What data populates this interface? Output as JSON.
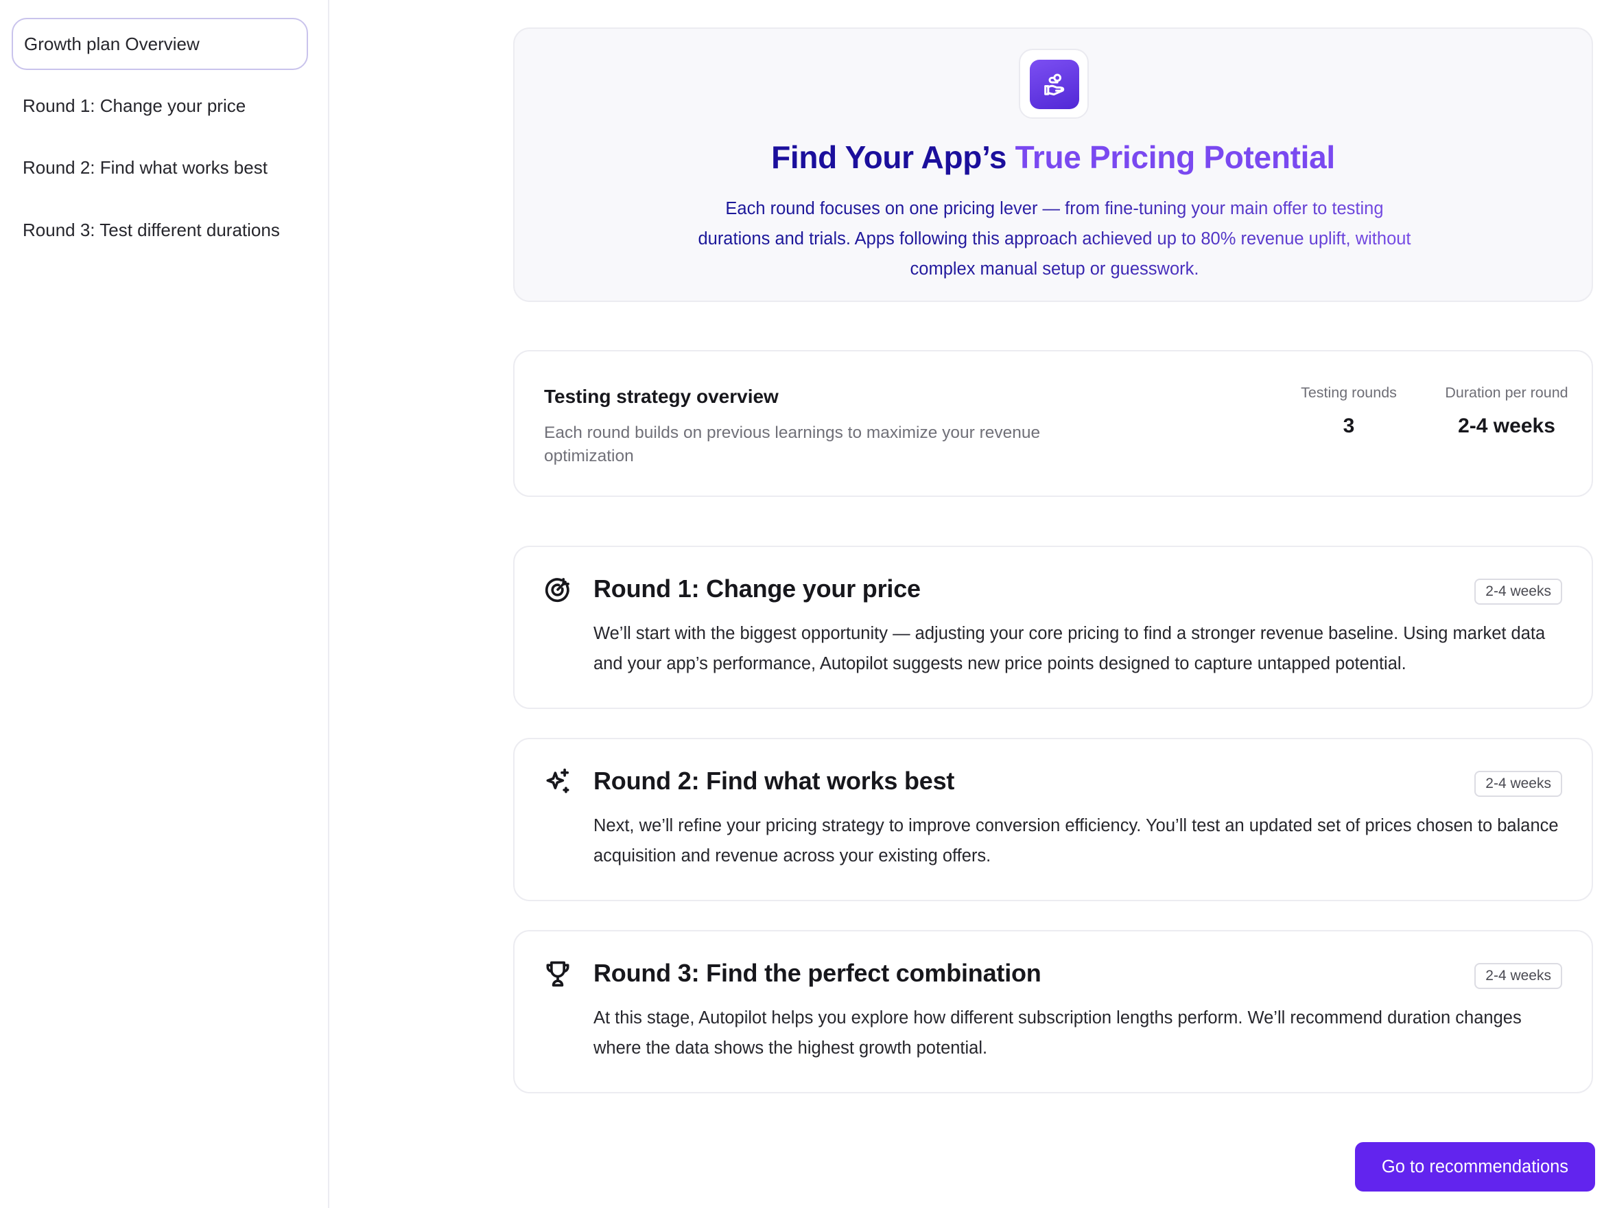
{
  "sidebar": {
    "items": [
      {
        "label": "Growth plan Overview",
        "active": true
      },
      {
        "label": "Round 1: Change your price"
      },
      {
        "label": "Round 2: Find what works best"
      },
      {
        "label": "Round 3: Test different durations"
      }
    ]
  },
  "hero": {
    "icon": "hand-coins-icon",
    "title_part1": "Find Your App’s ",
    "title_part2": "True Pricing Potential",
    "description": "Each round focuses on one pricing lever — from fine-tuning your main offer to testing durations and trials. Apps following this approach achieved up to 80% revenue uplift, without complex manual setup or guesswork."
  },
  "strategy": {
    "title": "Testing strategy overview",
    "description": "Each round builds on previous learnings to maximize your revenue optimization",
    "stats": [
      {
        "label": "Testing rounds",
        "value": "3"
      },
      {
        "label": "Duration per round",
        "value": "2-4 weeks"
      }
    ]
  },
  "rounds": [
    {
      "icon": "target-icon",
      "title": "Round 1: Change your price",
      "badge": "2-4 weeks",
      "description": "We’ll start with the biggest opportunity — adjusting your core pricing to find a stronger revenue baseline. Using market data and your app’s performance, Autopilot suggests new price points designed to capture untapped potential."
    },
    {
      "icon": "sparkles-icon",
      "title": "Round 2: Find what works best",
      "badge": "2-4 weeks",
      "description": "Next, we’ll refine your pricing strategy to improve conversion efficiency. You’ll test an updated set of prices chosen to balance acquisition and revenue across your existing offers."
    },
    {
      "icon": "trophy-icon",
      "title": "Round 3: Find the perfect combination",
      "badge": "2-4 weeks",
      "description": "At this stage, Autopilot helps you explore how different subscription lengths perform. We’ll recommend duration changes where the data shows the highest growth potential."
    }
  ],
  "cta": {
    "label": "Go to recommendations"
  },
  "colors": {
    "accent": "#6224ee",
    "title_dark": "#1b0f9c",
    "title_light": "#7a49f0"
  }
}
